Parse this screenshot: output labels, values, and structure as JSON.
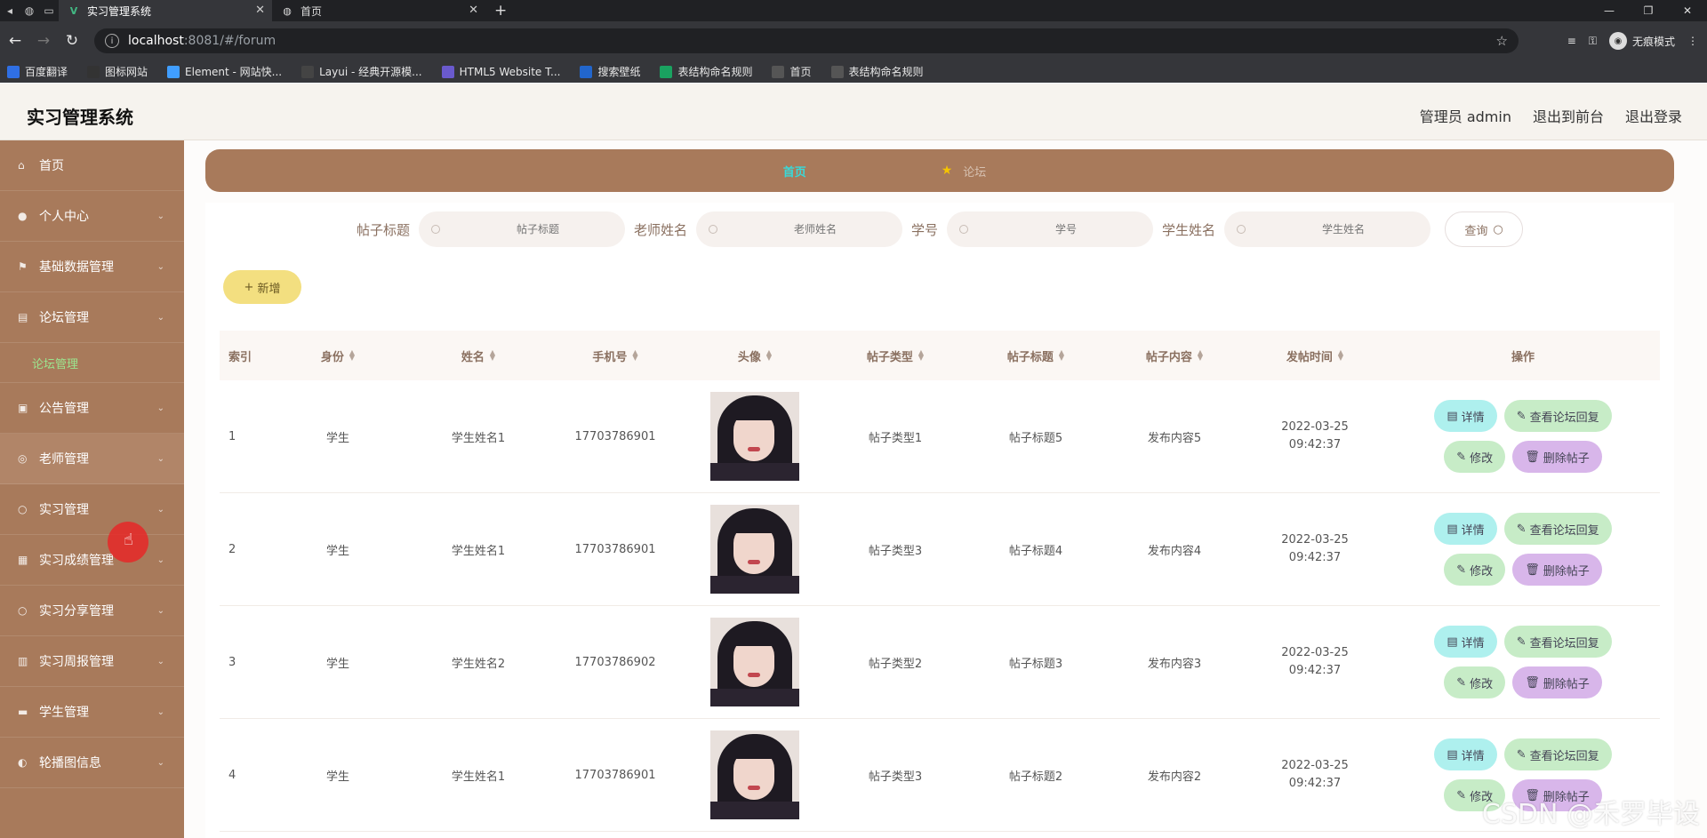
{
  "browser": {
    "tabs": [
      {
        "title": "实习管理系统",
        "active": true
      },
      {
        "title": "首页",
        "active": false
      }
    ],
    "url_host": "localhost",
    "url_path": ":8081/#/forum",
    "profile_label": "无痕模式",
    "bookmarks": [
      {
        "label": "百度翻译",
        "color": "#2f6fe4"
      },
      {
        "label": "图标网站",
        "color": "#333333"
      },
      {
        "label": "Element - 网站快...",
        "color": "#409eff"
      },
      {
        "label": "Layui - 经典开源模...",
        "color": "#444444"
      },
      {
        "label": "HTML5 Website T...",
        "color": "#6a5acd"
      },
      {
        "label": "搜索壁纸",
        "color": "#2266cc"
      },
      {
        "label": "表结构命名规则",
        "color": "#1aa260"
      },
      {
        "label": "首页",
        "color": "#555555"
      },
      {
        "label": "表结构命名规则",
        "color": "#555555"
      }
    ]
  },
  "header": {
    "brand": "实习管理系统",
    "user_label": "管理员 admin",
    "back_label": "退出到前台",
    "logout_label": "退出登录"
  },
  "sidebar": {
    "items": [
      {
        "label": "首页",
        "icon": "home-icon"
      },
      {
        "label": "个人中心",
        "icon": "user-icon"
      },
      {
        "label": "基础数据管理",
        "icon": "flag-icon"
      },
      {
        "label": "论坛管理",
        "icon": "forum-icon"
      },
      {
        "label": "论坛管理",
        "icon": "",
        "sub": true
      },
      {
        "label": "公告管理",
        "icon": "notice-icon"
      },
      {
        "label": "老师管理",
        "icon": "teacher-icon"
      },
      {
        "label": "实习管理",
        "icon": "intern-icon"
      },
      {
        "label": "实习成绩管理",
        "icon": "score-icon"
      },
      {
        "label": "实习分享管理",
        "icon": "share-icon"
      },
      {
        "label": "实习周报管理",
        "icon": "report-icon"
      },
      {
        "label": "学生管理",
        "icon": "student-icon"
      },
      {
        "label": "轮播图信息",
        "icon": "carousel-icon"
      }
    ]
  },
  "breadcrumb": {
    "home": "首页",
    "current": "论坛"
  },
  "search": {
    "title_label": "帖子标题",
    "title_placeholder": "帖子标题",
    "teacher_label": "老师姓名",
    "teacher_placeholder": "老师姓名",
    "stuno_label": "学号",
    "stuno_placeholder": "学号",
    "student_label": "学生姓名",
    "student_placeholder": "学生姓名",
    "query_label": "查询"
  },
  "add_label": "新增",
  "table": {
    "headers": [
      "索引",
      "身份",
      "姓名",
      "手机号",
      "头像",
      "帖子类型",
      "帖子标题",
      "帖子内容",
      "发帖时间",
      "操作"
    ],
    "rows": [
      {
        "index": "1",
        "role": "学生",
        "name": "学生姓名1",
        "phone": "17703786901",
        "type": "帖子类型1",
        "title": "帖子标题5",
        "content": "发布内容5",
        "time": "2022-03-25 09:42:37"
      },
      {
        "index": "2",
        "role": "学生",
        "name": "学生姓名1",
        "phone": "17703786901",
        "type": "帖子类型3",
        "title": "帖子标题4",
        "content": "发布内容4",
        "time": "2022-03-25 09:42:37"
      },
      {
        "index": "3",
        "role": "学生",
        "name": "学生姓名2",
        "phone": "17703786902",
        "type": "帖子类型2",
        "title": "帖子标题3",
        "content": "发布内容3",
        "time": "2022-03-25 09:42:37"
      },
      {
        "index": "4",
        "role": "学生",
        "name": "学生姓名1",
        "phone": "17703786901",
        "type": "帖子类型3",
        "title": "帖子标题2",
        "content": "发布内容2",
        "time": "2022-03-25 09:42:37"
      }
    ],
    "actions": {
      "detail": "详情",
      "reply": "查看论坛回复",
      "edit": "修改",
      "delete": "删除帖子"
    }
  },
  "watermark": "CSDN @禾罗毕设"
}
